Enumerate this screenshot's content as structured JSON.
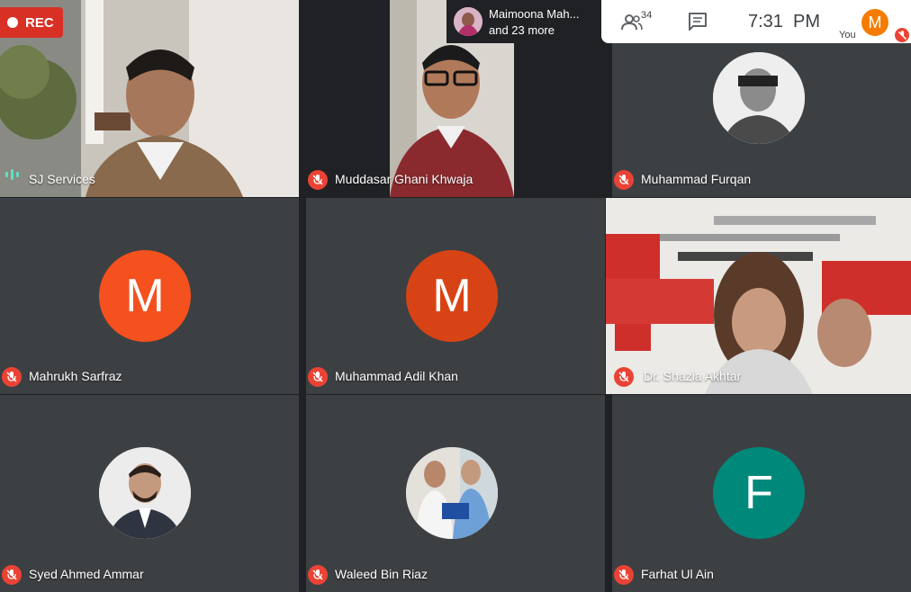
{
  "recording": {
    "label": "REC"
  },
  "presenter_bar": {
    "line1": "Maimoona Mah...",
    "line2": "and 23 more"
  },
  "toolbar": {
    "participant_count": "34",
    "time": "7:31  PM",
    "you_label": "You",
    "you_initial": "M"
  },
  "tiles": [
    {
      "name": "SJ Services"
    },
    {
      "name": "Muddasar Ghani Khwaja"
    },
    {
      "name": "Muhammad Furqan"
    },
    {
      "name": "Mahrukh Sarfraz",
      "initial": "M",
      "color": "#f4511e"
    },
    {
      "name": "Muhammad Adil Khan",
      "initial": "M",
      "color": "#d84315"
    },
    {
      "name": "Dr. Shazia Akhtar"
    },
    {
      "name": "Syed Ahmed Ammar"
    },
    {
      "name": "Waleed Bin Riaz"
    },
    {
      "name": "Farhat Ul Ain",
      "initial": "F",
      "color": "#00897b"
    }
  ],
  "colors": {
    "background": "#202124",
    "mute_red": "#ea4335",
    "rec_red": "#d93025",
    "you_avatar": "#f57c00"
  },
  "icons": [
    "mic-off-icon",
    "people-icon",
    "chat-icon",
    "audio-active-icon"
  ]
}
